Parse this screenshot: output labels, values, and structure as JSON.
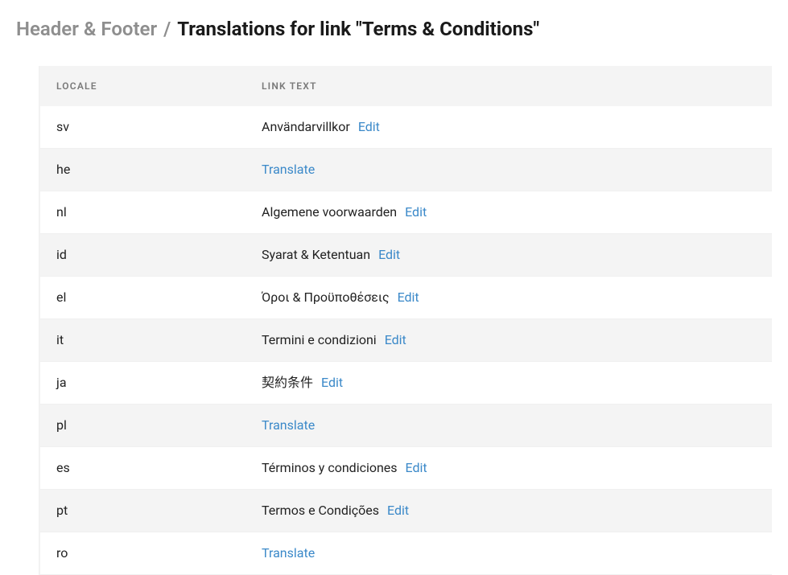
{
  "breadcrumb": {
    "prev": "Header & Footer",
    "sep": "/",
    "current": "Translations for link \"Terms & Conditions\""
  },
  "table": {
    "headers": {
      "locale": "LOCALE",
      "link_text": "LINK TEXT"
    },
    "rows": [
      {
        "locale": "sv",
        "text": "Användarvillkor",
        "action": "Edit"
      },
      {
        "locale": "he",
        "text": "",
        "action": "Translate"
      },
      {
        "locale": "nl",
        "text": "Algemene voorwaarden",
        "action": "Edit"
      },
      {
        "locale": "id",
        "text": "Syarat & Ketentuan",
        "action": "Edit"
      },
      {
        "locale": "el",
        "text": "Όροι & Προϋποθέσεις",
        "action": "Edit"
      },
      {
        "locale": "it",
        "text": "Termini e condizioni",
        "action": "Edit"
      },
      {
        "locale": "ja",
        "text": "契約条件",
        "action": "Edit"
      },
      {
        "locale": "pl",
        "text": "",
        "action": "Translate"
      },
      {
        "locale": "es",
        "text": "Términos y condiciones",
        "action": "Edit"
      },
      {
        "locale": "pt",
        "text": "Termos e Condições",
        "action": "Edit"
      },
      {
        "locale": "ro",
        "text": "",
        "action": "Translate"
      }
    ]
  }
}
